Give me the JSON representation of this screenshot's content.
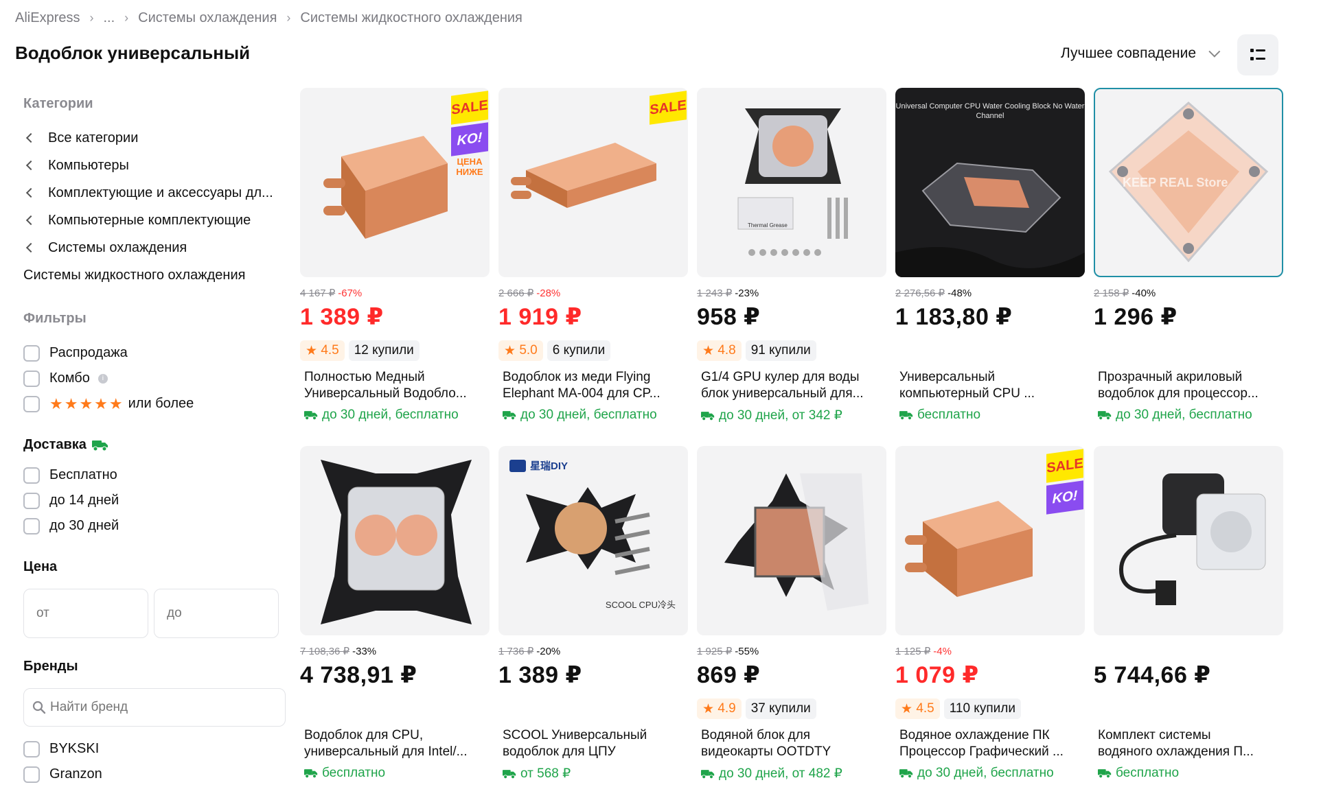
{
  "breadcrumbs": [
    {
      "label": "AliExpress"
    },
    {
      "label": "..."
    },
    {
      "label": "Системы охлаждения"
    },
    {
      "label": "Системы жидкостного охлаждения"
    }
  ],
  "page_title": "Водоблок универсальный",
  "sort": {
    "label": "Лучшее совпадение"
  },
  "sidebar": {
    "categories_heading": "Категории",
    "categories": [
      {
        "label": "Все категории"
      },
      {
        "label": "Компьютеры"
      },
      {
        "label": "Комплектующие и аксессуары дл..."
      },
      {
        "label": "Компьютерные комплектующие"
      },
      {
        "label": "Системы охлаждения"
      }
    ],
    "current_category": "Системы жидкостного охлаждения",
    "filters_heading": "Фильтры",
    "filters": [
      {
        "label": "Распродажа"
      },
      {
        "label": "Комбо"
      },
      {
        "label": "или более",
        "stars": "★★★★★"
      }
    ],
    "delivery_heading": "Доставка",
    "delivery_options": [
      {
        "label": "Бесплатно"
      },
      {
        "label": "до 14 дней"
      },
      {
        "label": "до 30 дней"
      }
    ],
    "price_heading": "Цена",
    "price_from_placeholder": "от",
    "price_to_placeholder": "до",
    "brands_heading": "Бренды",
    "brand_search_placeholder": "Найти бренд",
    "brands": [
      {
        "label": "BYKSKI"
      },
      {
        "label": "Granzon"
      }
    ]
  },
  "colors": {
    "price_red": "#ff2a2a",
    "delivery_green": "#1fa44a",
    "rating_orange": "#ff7a1a"
  },
  "products": [
    {
      "old_price": "4 167 ₽",
      "discount": "-67%",
      "price": "1 389 ₽",
      "rating": "4.5",
      "bought": "12 купили",
      "title_line1": "Полностью Медный",
      "title_line2": "Универсальный Водобло...",
      "delivery": "до 30 дней, бесплатно",
      "sale": {
        "s1": "SALE",
        "s2": "KO!",
        "s3": "ЦЕНА НИЖЕ"
      },
      "image": "copper-block"
    },
    {
      "old_price": "2 666 ₽",
      "discount": "-28%",
      "price": "1 919 ₽",
      "rating": "5.0",
      "bought": "6 купили",
      "title_line1": "Водоблок из меди Flying",
      "title_line2": "Elephant MA-004 для CP...",
      "delivery": "до 30 дней, бесплатно",
      "sale": {
        "s1": "SALE"
      },
      "image": "copper-long-block"
    },
    {
      "old_price": "1 243 ₽",
      "discount": "-23%",
      "price": "958 ₽",
      "rating": "4.8",
      "bought": "91 купили",
      "title_line1": "G1/4 GPU кулер для воды",
      "title_line2": "блок универсальный для...",
      "delivery": "до 30 дней, от 342 ₽",
      "image": "gpu-block-kit",
      "image_caption": "Thermal Grease"
    },
    {
      "old_price": "2 276,56 ₽",
      "discount": "-48%",
      "price": "1 183,80 ₽",
      "title_line1": "Универсальный",
      "title_line2": "компьютерный CPU ...",
      "delivery": "бесплатно",
      "image": "dark-cpu-block",
      "image_caption": "Universal Computer CPU Water Cooling Block No Water Channel"
    },
    {
      "old_price": "2 158 ₽",
      "discount": "-40%",
      "price": "1 296 ₽",
      "title_line1": "Прозрачный акриловый",
      "title_line2": "водоблок для процессор...",
      "delivery": "до 30 дней, бесплатно",
      "image": "acrylic-block",
      "image_caption": "KEEP REAL Store"
    },
    {
      "old_price": "7 108,36 ₽",
      "discount": "-33%",
      "price": "4 738,91 ₽",
      "title_line1": "Водоблок для CPU,",
      "title_line2": "универсальный для Intel/...",
      "delivery": "бесплатно",
      "image": "cpu-block-bracket"
    },
    {
      "old_price": "1 736 ₽",
      "discount": "-20%",
      "price": "1 389 ₽",
      "title_line1": "SCOOL Универсальный",
      "title_line2": "водоблок для ЦПУ",
      "delivery": "от 568 ₽",
      "image": "scool-block",
      "image_brand": "星瑞DIY",
      "image_caption": "SCOOL CPU冷头"
    },
    {
      "old_price": "1 925 ₽",
      "discount": "-55%",
      "price": "869 ₽",
      "rating": "4.9",
      "bought": "37 купили",
      "title_line1": "Водяной блок для",
      "title_line2": "видеокарты OOTDTY",
      "delivery": "до 30 дней, от 482 ₽",
      "image": "gpu-copper-plate"
    },
    {
      "old_price": "1 125 ₽",
      "discount": "-4%",
      "price": "1 079 ₽",
      "rating": "4.5",
      "bought": "110 купили",
      "title_line1": "Водяное охлаждение ПК",
      "title_line2": "Процессор Графический ...",
      "delivery": "до 30 дней, бесплатно",
      "sale": {
        "s1": "SALE",
        "s2": "KO!"
      },
      "image": "copper-block-small"
    },
    {
      "price": "5 744,66 ₽",
      "title_line1": "Комплект системы",
      "title_line2": "водяного охлаждения П...",
      "delivery": "бесплатно",
      "image": "pump-kit"
    }
  ]
}
